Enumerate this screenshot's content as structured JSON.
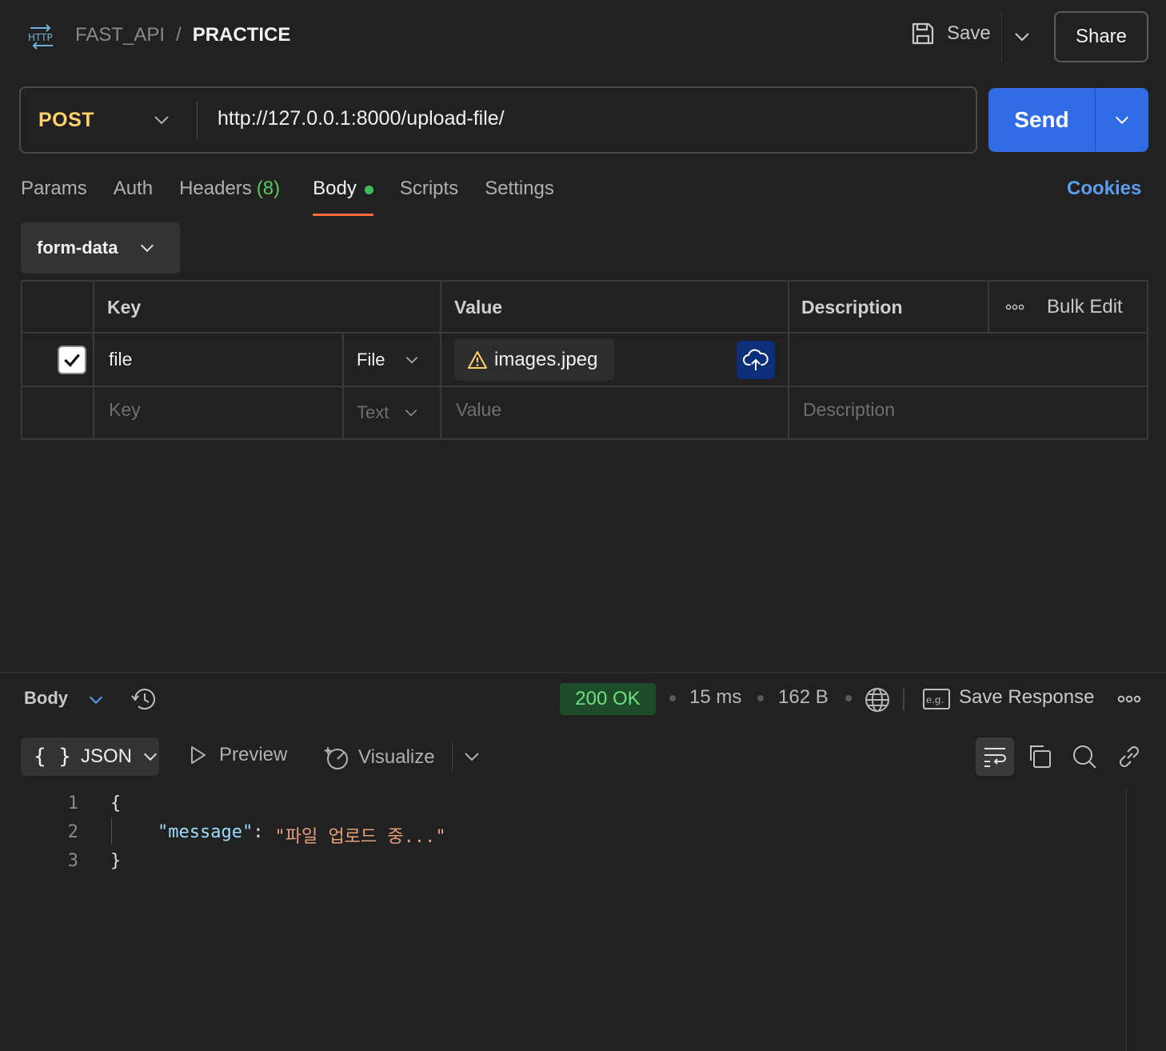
{
  "header": {
    "breadcrumb_parent": "FAST_API",
    "breadcrumb_sep": "/",
    "breadcrumb_current": "PRACTICE",
    "save_label": "Save",
    "share_label": "Share"
  },
  "request": {
    "method": "POST",
    "url": "http://127.0.0.1:8000/upload-file/",
    "send_label": "Send"
  },
  "tabs": [
    {
      "label": "Params"
    },
    {
      "label": "Auth"
    },
    {
      "label": "Headers",
      "count": "(8)"
    },
    {
      "label": "Body",
      "active": true
    },
    {
      "label": "Scripts"
    },
    {
      "label": "Settings"
    }
  ],
  "cookies_label": "Cookies",
  "body_mode": "form-data",
  "table": {
    "headers": {
      "key": "Key",
      "value": "Value",
      "description": "Description",
      "bulk_edit": "Bulk Edit"
    },
    "rows": [
      {
        "checked": true,
        "key": "file",
        "type": "File",
        "value": "images.jpeg",
        "description": ""
      }
    ],
    "new_row": {
      "key_placeholder": "Key",
      "type": "Text",
      "value_placeholder": "Value",
      "description_placeholder": "Description"
    }
  },
  "response": {
    "section_label": "Body",
    "status": "200 OK",
    "time": "15 ms",
    "size": "162 B",
    "save_response_label": "Save Response",
    "format": "JSON",
    "preview_label": "Preview",
    "visualize_label": "Visualize",
    "code_lines": [
      {
        "num": "1",
        "text": "{"
      },
      {
        "num": "2",
        "key": "\"message\"",
        "colon": ":",
        "value": "\"파일 업로드 중...\""
      },
      {
        "num": "3",
        "text": "}"
      }
    ]
  },
  "colors": {
    "accent_send": "#2f6ce6",
    "method_post": "#ffd16b",
    "active_tab_underline": "#ff6c37",
    "status_ok": "#6fe07f",
    "json_key": "#9cdcfe",
    "json_string": "#e8a07a"
  }
}
